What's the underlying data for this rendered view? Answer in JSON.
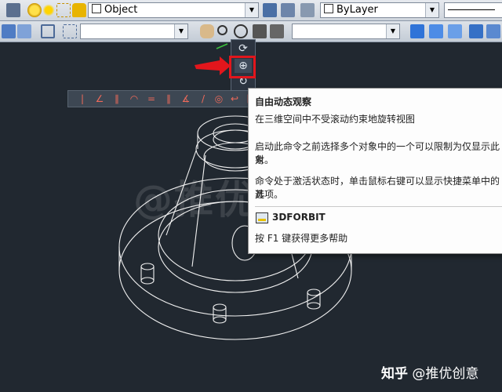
{
  "toolbar1": {
    "layer_combo": "Object",
    "linetype_combo": "ByLayer"
  },
  "tooltip": {
    "title": "自由动态观察",
    "line1": "在三维空间中不受滚动约束地旋转视图",
    "line2a": "启动此命令之前选择多个对象中的一个可以限制为仅显示此对",
    "line2b": "象。",
    "line3a": "命令处于激活状态时，单击鼠标右键可以显示快捷菜单中的其",
    "line3b": "选项。",
    "command": "3DFORBIT",
    "help": "按 F1 键获得更多帮助"
  },
  "overlay": {
    "watermark": "@推优创意",
    "credit_brand": "知乎",
    "credit_user": "@推优创意"
  },
  "colors": {
    "canvas_bg": "#212830",
    "highlight_box": "#e2161c",
    "arrow": "#e2161c",
    "wireframe": "#ffffff"
  },
  "icons": [
    "layer-manager-icon",
    "light-bulb-icon",
    "sun-icon",
    "freeze-icon",
    "lock-icon",
    "pan-hand-icon",
    "zoom-icon",
    "orbit-icon",
    "free-orbit-icon",
    "continuous-orbit-icon",
    "command-icon"
  ]
}
